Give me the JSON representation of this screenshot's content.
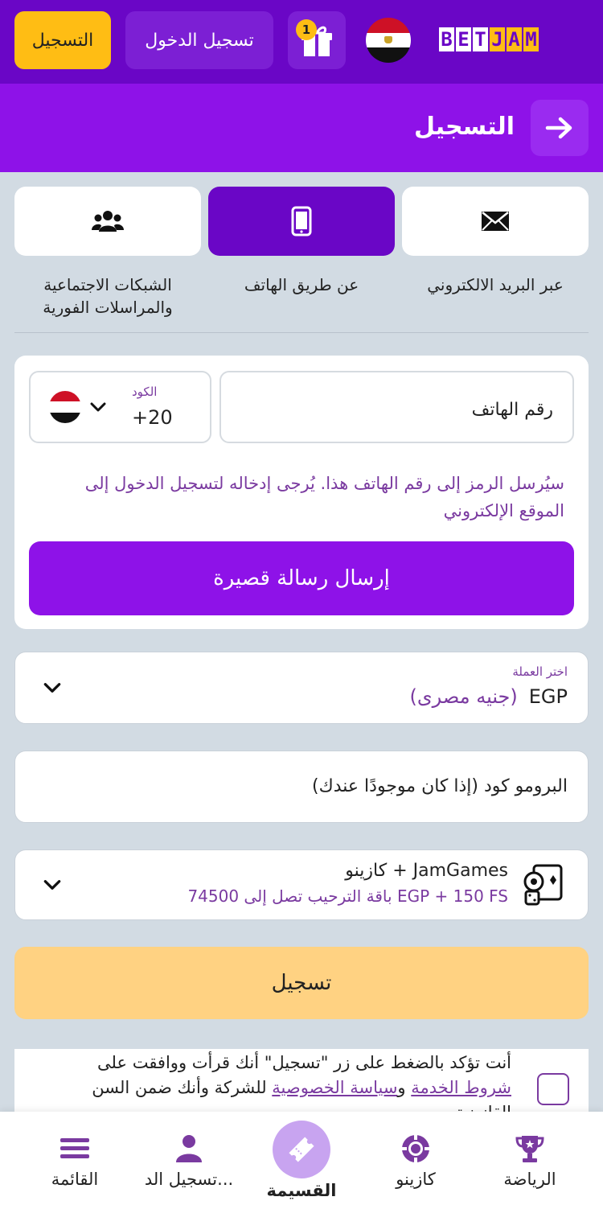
{
  "header": {
    "register_label": "التسجيل",
    "login_label": "تسجيل الدخول",
    "gift_badge_count": "1",
    "logo_letters": [
      "B",
      "E",
      "T",
      "J",
      "A",
      "M"
    ],
    "logo_text": "BETJAM"
  },
  "title_bar": {
    "title": "التسجيل",
    "back_icon": "arrow-right-icon"
  },
  "tabs": [
    {
      "label": "عبر البريد الالكتروني",
      "icon": "envelope-icon",
      "active": false
    },
    {
      "label": "عن طريق الهاتف",
      "icon": "mobile-phone-icon",
      "active": true
    },
    {
      "label_line1": "الشبكات الاجتماعية",
      "label_line2": "والمراسلات الفورية",
      "icon": "users-icon",
      "active": false
    }
  ],
  "phone_form": {
    "phone_placeholder": "رقم الهاتف",
    "code_label": "الكود",
    "code_value": "+20",
    "hint": "سيُرسل الرمز إلى رقم الهاتف هذا. يُرجى إدخاله لتسجيل الدخول إلى الموقع الإلكتروني",
    "send_sms_label": "إرسال رسالة قصيرة"
  },
  "currency": {
    "label": "اختر العملة",
    "code": "EGP",
    "name": "(جنيه مصرى)"
  },
  "promo": {
    "placeholder": "البرومو كود (إذا كان موجودًا عندك)"
  },
  "bonus": {
    "title": "كازينو + JamGames",
    "subtitle": "باقة الترحيب تصل إلى 74500 EGP + 150 FS"
  },
  "register_button": "تسجيل",
  "terms": {
    "part1": "أنت تؤكد بالضغط على زر \"تسجيل\" أنك قرأت ووافقت على ",
    "terms_link": "شروط الخدمة",
    "part2": " و",
    "privacy_link": "سياسة الخصوصية",
    "part3": " للشركة وأنك ضمن السن القانونية"
  },
  "bottom_nav": {
    "sports": "الرياضة",
    "casino": "كازينو",
    "coupon": "القسيمة",
    "login": "تسجيل الد...",
    "menu": "القائمة"
  },
  "colors": {
    "brand_purple": "#6a06c6",
    "title_purple": "#8e12e8",
    "accent_yellow": "#ffbd14",
    "register_light": "#ffd282",
    "text_purple": "#7a3aa0",
    "background": "#d2dbe3"
  }
}
